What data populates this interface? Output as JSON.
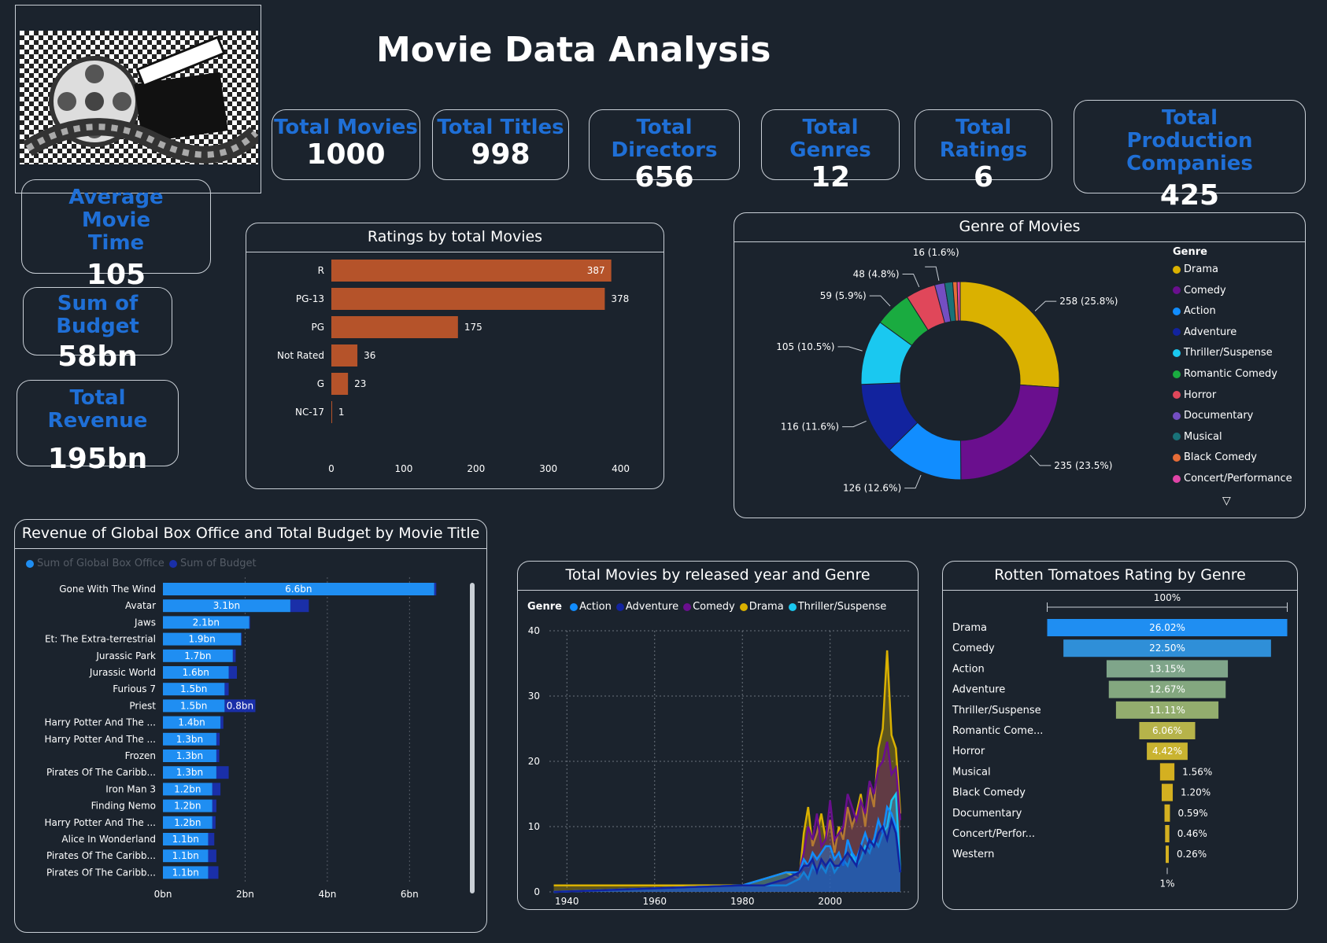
{
  "title": "Movie Data Analysis",
  "kpis": {
    "total_movies": {
      "label": "Total Movies",
      "value": "1000"
    },
    "total_titles": {
      "label": "Total Titles",
      "value": "998"
    },
    "total_directors": {
      "label": "Total Directors",
      "value": "656"
    },
    "total_genres": {
      "label": "Total Genres",
      "value": "12"
    },
    "total_ratings": {
      "label": "Total Ratings",
      "value": "6"
    },
    "total_production": {
      "label": "Total Production Companies",
      "value": "425"
    },
    "avg_time": {
      "label": "Average Movie Time",
      "value": "105"
    },
    "sum_budget": {
      "label": "Sum of Budget",
      "value": "58bn"
    },
    "total_revenue": {
      "label": "Total Revenue",
      "value": "195bn"
    }
  },
  "colors": {
    "background": "#1b232d",
    "kpi_label": "#1f6fd6",
    "bar_orange": "#b5532a",
    "bar_blue": "#1f8ef2",
    "bar_navy": "#1a2fa8"
  },
  "chart_data": [
    {
      "type": "bar",
      "orientation": "horizontal",
      "title": "Ratings by total Movies",
      "categories": [
        "R",
        "PG-13",
        "PG",
        "Not Rated",
        "G",
        "NC-17"
      ],
      "values": [
        387,
        378,
        175,
        36,
        23,
        1
      ],
      "xlim": [
        0,
        420
      ],
      "xticks": [
        0,
        100,
        200,
        300,
        400
      ],
      "grid": false
    },
    {
      "type": "pie",
      "donut": true,
      "title": "Genre of Movies",
      "legend_title": "Genre",
      "legend_position": "right",
      "labels": [
        "Drama",
        "Comedy",
        "Action",
        "Adventure",
        "Thriller/Suspense",
        "Romantic Comedy",
        "Horror",
        "Documentary",
        "Musical",
        "Black Comedy",
        "Concert/Performance"
      ],
      "values": [
        258,
        235,
        126,
        116,
        105,
        59,
        48,
        16,
        13,
        7,
        5
      ],
      "colors": [
        "#dab100",
        "#6a0f8e",
        "#118dff",
        "#12239e",
        "#1ac8f0",
        "#1aab40",
        "#e0475a",
        "#744ec2",
        "#197278",
        "#e66c37",
        "#e044a7"
      ],
      "data_labels": [
        "258 (25.8%)",
        "235 (23.5%)",
        "126 (12.6%)",
        "116 (11.6%)",
        "105 (10.5%)",
        "59 (5.9%)",
        "48 (4.8%)",
        "16 (1.6%)"
      ]
    },
    {
      "type": "bar",
      "orientation": "horizontal",
      "title": "Revenue of Global Box Office and Total Budget by Movie Title",
      "legend_position": "top-left",
      "series_names": [
        "Sum of Global Box Office",
        "Sum of Budget"
      ],
      "categories": [
        "Gone With The Wind",
        "Avatar",
        "Jaws",
        "Et: The Extra-terrestrial",
        "Jurassic Park",
        "Jurassic World",
        "Furious 7",
        "Priest",
        "Harry Potter And The ...",
        "Harry Potter And The ...",
        "Frozen",
        "Pirates Of The Caribb...",
        "Iron Man 3",
        "Finding Nemo",
        "Harry Potter And The ...",
        "Alice In Wonderland",
        "Pirates Of The Caribb...",
        "Pirates Of The Caribb..."
      ],
      "series": [
        {
          "name": "Sum of Global Box Office",
          "values": [
            6.6,
            3.1,
            2.1,
            1.9,
            1.7,
            1.6,
            1.5,
            1.5,
            1.4,
            1.3,
            1.3,
            1.3,
            1.2,
            1.2,
            1.2,
            1.1,
            1.1,
            1.1
          ]
        },
        {
          "name": "Sum of Budget",
          "values": [
            0.05,
            0.45,
            0.02,
            0.02,
            0.07,
            0.2,
            0.1,
            0.75,
            0.07,
            0.08,
            0.07,
            0.3,
            0.2,
            0.1,
            0.08,
            0.15,
            0.2,
            0.25
          ]
        }
      ],
      "value_labels": [
        "6.6bn",
        "3.1bn",
        "2.1bn",
        "1.9bn",
        "1.7bn",
        "1.6bn",
        "1.5bn",
        "1.5bn",
        "1.4bn",
        "1.3bn",
        "1.3bn",
        "1.3bn",
        "1.2bn",
        "1.2bn",
        "1.2bn",
        "1.1bn",
        "1.1bn",
        "1.1bn"
      ],
      "budget_label": "0.8bn",
      "xticks": [
        "0bn",
        "2bn",
        "4bn",
        "6bn"
      ],
      "xlim": [
        0,
        7.2
      ]
    },
    {
      "type": "area",
      "title": "Total Movies by released year and Genre",
      "legend_title": "Genre",
      "legend_position": "top-left",
      "series_names": [
        "Action",
        "Adventure",
        "Comedy",
        "Drama",
        "Thriller/Suspense"
      ],
      "series_colors": [
        "#118dff",
        "#12239e",
        "#6a0f8e",
        "#dab100",
        "#1ac8f0"
      ],
      "x": [
        1937,
        1980,
        1985,
        1990,
        1993,
        1994,
        1995,
        1996,
        1997,
        1998,
        1999,
        2000,
        2001,
        2002,
        2003,
        2004,
        2005,
        2006,
        2007,
        2008,
        2009,
        2010,
        2011,
        2012,
        2013,
        2014,
        2015,
        2016
      ],
      "series": [
        {
          "name": "Action",
          "values": [
            0,
            1,
            2,
            3,
            3,
            5,
            4,
            6,
            5,
            6,
            7,
            7,
            5,
            6,
            4,
            8,
            6,
            5,
            7,
            9,
            7,
            8,
            11,
            9,
            13,
            12,
            10,
            3
          ]
        },
        {
          "name": "Adventure",
          "values": [
            0,
            1,
            1,
            2,
            3,
            4,
            4,
            5,
            3,
            5,
            4,
            5,
            4,
            4,
            5,
            6,
            5,
            4,
            7,
            6,
            8,
            7,
            9,
            10,
            8,
            11,
            9,
            3
          ]
        },
        {
          "name": "Comedy",
          "values": [
            0,
            1,
            1,
            2,
            3,
            6,
            10,
            8,
            12,
            7,
            8,
            14,
            8,
            9,
            10,
            15,
            13,
            11,
            14,
            12,
            17,
            15,
            19,
            20,
            23,
            18,
            19,
            11
          ]
        },
        {
          "name": "Drama",
          "values": [
            1,
            1,
            2,
            3,
            2,
            9,
            13,
            7,
            9,
            12,
            8,
            11,
            6,
            10,
            8,
            13,
            10,
            12,
            15,
            10,
            16,
            13,
            22,
            25,
            37,
            24,
            22,
            12
          ]
        },
        {
          "name": "Thriller/Suspense",
          "values": [
            0,
            1,
            1,
            1,
            2,
            3,
            2,
            4,
            3,
            4,
            3,
            5,
            3,
            4,
            5,
            4,
            6,
            4,
            5,
            7,
            6,
            8,
            7,
            9,
            10,
            14,
            15,
            3
          ]
        }
      ],
      "xticks": [
        1940,
        1960,
        1980,
        2000
      ],
      "xlim": [
        1936,
        2018
      ],
      "ylim": [
        0,
        40
      ],
      "yticks": [
        0,
        10,
        20,
        30,
        40
      ]
    },
    {
      "type": "bar",
      "subtype": "funnel",
      "title": "Rotten Tomatoes Rating by Genre",
      "top_label": "100%",
      "bottom_label": "1%",
      "categories": [
        "Drama",
        "Comedy",
        "Action",
        "Adventure",
        "Thriller/Suspense",
        "Romantic Come...",
        "Horror",
        "Musical",
        "Black Comedy",
        "Documentary",
        "Concert/Perfor...",
        "Western"
      ],
      "values": [
        26.02,
        22.5,
        13.15,
        12.67,
        11.11,
        6.06,
        4.42,
        1.56,
        1.2,
        0.59,
        0.46,
        0.26
      ],
      "value_labels": [
        "26.02%",
        "22.50%",
        "13.15%",
        "12.67%",
        "11.11%",
        "6.06%",
        "4.42%",
        "1.56%",
        "1.20%",
        "0.59%",
        "0.46%",
        "0.26%"
      ],
      "colors": [
        "#1f8ef2",
        "#2f8fd8",
        "#7fa58a",
        "#83a77f",
        "#93ad6e",
        "#b6b34a",
        "#c9b330",
        "#d4b020",
        "#d4b020",
        "#d4b020",
        "#d4b020",
        "#d4b020"
      ]
    }
  ]
}
